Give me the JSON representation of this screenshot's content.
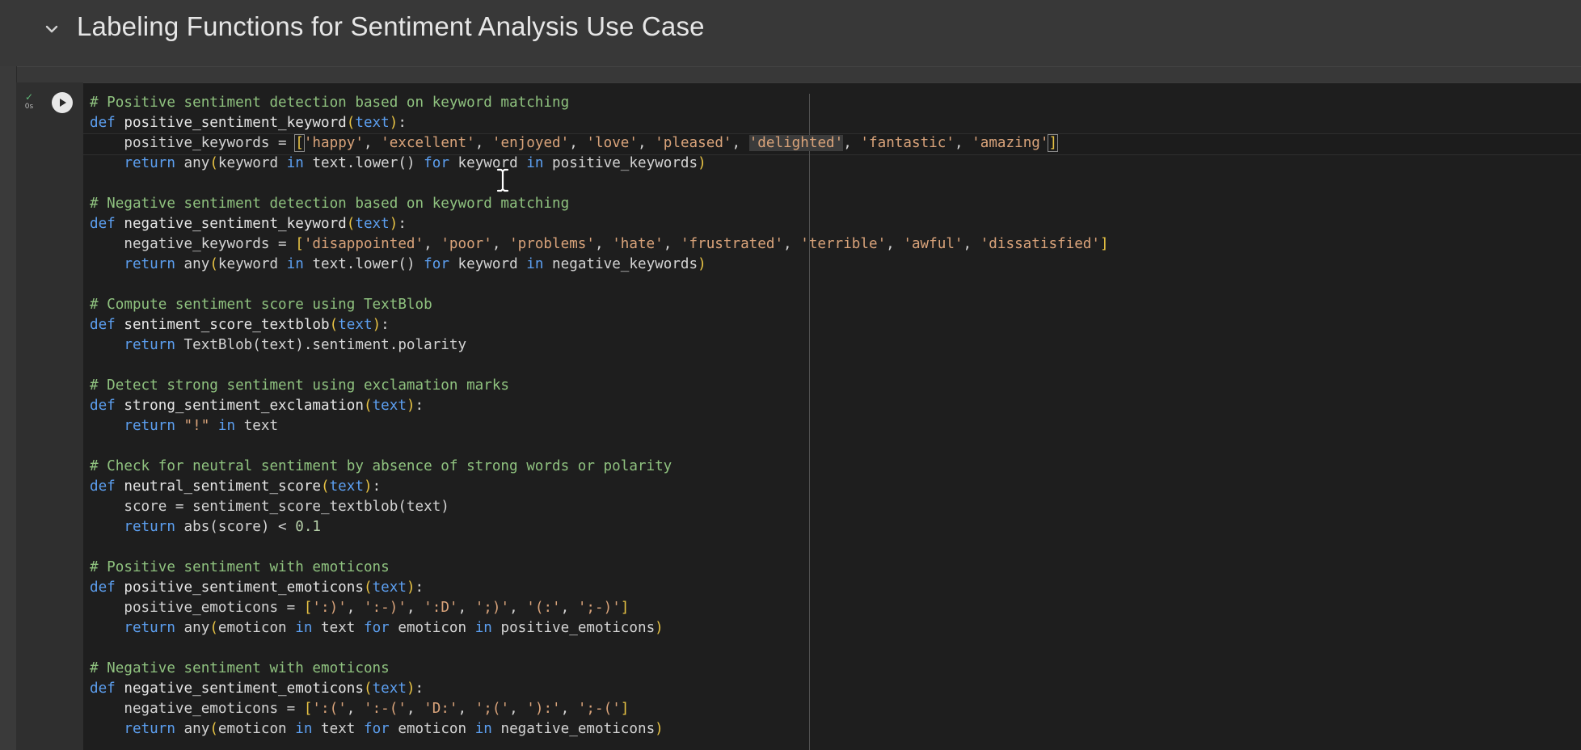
{
  "section": {
    "title": "Labeling Functions for Sentiment Analysis Use Case",
    "collapse_icon": "chevron-down-icon"
  },
  "cell": {
    "status_check": "✓",
    "exec_time": "0s",
    "run_icon": "play-icon",
    "code": {
      "c1": "# Positive sentiment detection based on keyword matching",
      "def1_name": "positive_sentiment_keyword",
      "def1_param": "text",
      "pos_kw_var": "positive_keywords",
      "pos_kw": [
        "'happy'",
        "'excellent'",
        "'enjoyed'",
        "'love'",
        "'pleased'",
        "'delighted'",
        "'fantastic'",
        "'amazing'"
      ],
      "ret1_a": "any",
      "ret1_b": "keyword",
      "ret1_c": "text.lower()",
      "ret1_d": "keyword",
      "ret1_e": "positive_keywords",
      "c2": "# Negative sentiment detection based on keyword matching",
      "def2_name": "negative_sentiment_keyword",
      "neg_kw_var": "negative_keywords",
      "neg_kw": [
        "'disappointed'",
        "'poor'",
        "'problems'",
        "'hate'",
        "'frustrated'",
        "'terrible'",
        "'awful'",
        "'dissatisfied'"
      ],
      "ret2_e": "negative_keywords",
      "c3": "# Compute sentiment score using TextBlob",
      "def3_name": "sentiment_score_textblob",
      "ret3": "TextBlob(text).sentiment.polarity",
      "c4": "# Detect strong sentiment using exclamation marks",
      "def4_name": "strong_sentiment_exclamation",
      "ret4_str": "\"!\"",
      "ret4_rest": "text",
      "c5": "# Check for neutral sentiment by absence of strong words or polarity",
      "def5_name": "neutral_sentiment_score",
      "score_line": "score = sentiment_score_textblob(text)",
      "ret5_a": "abs(score) < ",
      "ret5_num": "0.1",
      "c6": "# Positive sentiment with emoticons",
      "def6_name": "positive_sentiment_emoticons",
      "pos_emo_var": "positive_emoticons",
      "pos_emo": [
        "':)'",
        "':-)'",
        "':D'",
        "';)'",
        "'(:'",
        "';-)'"
      ],
      "ret6_a": "emoticon",
      "ret6_b": "text",
      "ret6_c": "emoticon",
      "ret6_e": "positive_emoticons",
      "c7": "# Negative sentiment with emoticons",
      "def7_name": "negative_sentiment_emoticons",
      "neg_emo_var": "negative_emoticons",
      "neg_emo": [
        "':('",
        "':-('",
        "'D:'",
        "';('",
        "'):'",
        "';-('"
      ],
      "ret7_e": "negative_emoticons"
    }
  },
  "colors": {
    "comment": "#8fc27f",
    "keyword": "#5c9ff0",
    "string": "#d9a37a",
    "bracket": "#e8c344",
    "status_ok": "#5fb878"
  }
}
